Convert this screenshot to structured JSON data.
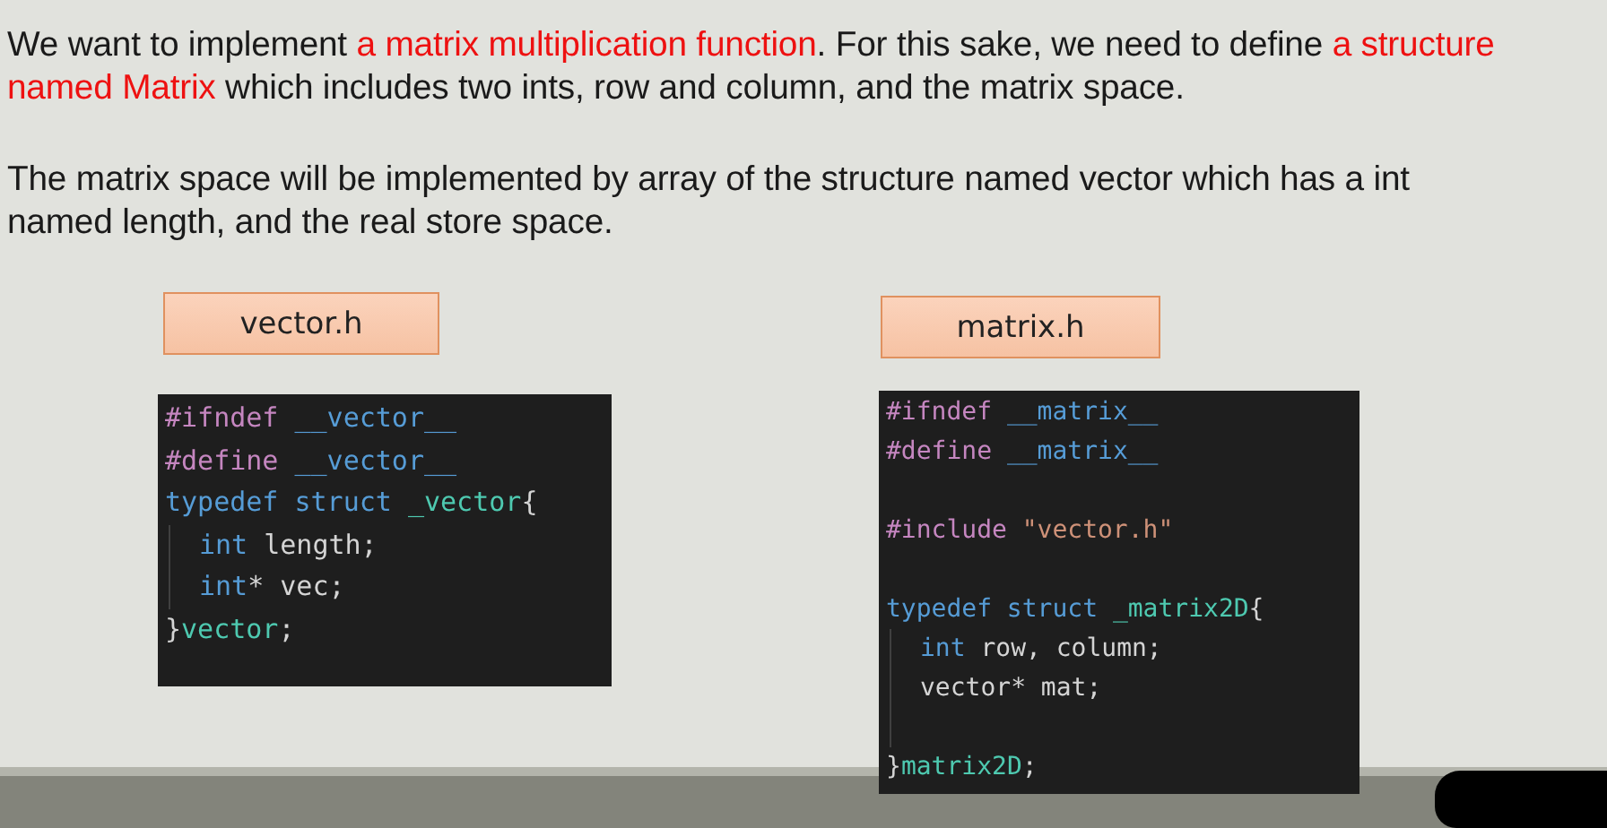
{
  "paragraphs": [
    {
      "segments": [
        {
          "text": "We want to implement ",
          "highlighted": false
        },
        {
          "text": "a matrix multiplication function",
          "highlighted": true
        },
        {
          "text": ". For this sake, we need to define ",
          "highlighted": false
        },
        {
          "text": "a structure named Matrix",
          "highlighted": true
        },
        {
          "text": " which includes two ints, row and column, and the matrix space.",
          "highlighted": false
        }
      ]
    },
    {
      "segments": [
        {
          "text": "The matrix space will be implemented by array of the structure named vector which has a int named length, and the real store space.",
          "highlighted": false
        }
      ]
    }
  ],
  "files": [
    {
      "name": "vector.h",
      "lines": [
        {
          "kind": "code",
          "tokens": [
            {
              "text": "#ifndef ",
              "kind": "directive"
            },
            {
              "text": "__vector__",
              "kind": "macro"
            }
          ]
        },
        {
          "kind": "code",
          "tokens": [
            {
              "text": "#define ",
              "kind": "directive"
            },
            {
              "text": "__vector__",
              "kind": "macro"
            }
          ]
        },
        {
          "kind": "code",
          "tokens": [
            {
              "text": "typedef struct ",
              "kind": "keyword"
            },
            {
              "text": "_vector",
              "kind": "type"
            },
            {
              "text": "{",
              "kind": "plain"
            }
          ],
          "children": [
            {
              "kind": "code",
              "tokens": [
                {
                  "text": "int ",
                  "kind": "keyword"
                },
                {
                  "text": "length;",
                  "kind": "plain"
                }
              ]
            },
            {
              "kind": "code",
              "tokens": [
                {
                  "text": "int",
                  "kind": "keyword"
                },
                {
                  "text": "* vec;",
                  "kind": "plain"
                }
              ]
            }
          ]
        },
        {
          "kind": "code",
          "tokens": [
            {
              "text": "}",
              "kind": "plain"
            },
            {
              "text": "vector",
              "kind": "type"
            },
            {
              "text": ";",
              "kind": "plain"
            }
          ]
        }
      ]
    },
    {
      "name": "matrix.h",
      "lines": [
        {
          "kind": "code",
          "tokens": [
            {
              "text": "#ifndef ",
              "kind": "directive"
            },
            {
              "text": "__matrix__",
              "kind": "macro"
            }
          ]
        },
        {
          "kind": "code",
          "tokens": [
            {
              "text": "#define ",
              "kind": "directive"
            },
            {
              "text": "__matrix__",
              "kind": "macro"
            }
          ]
        },
        {
          "kind": "blank"
        },
        {
          "kind": "code",
          "tokens": [
            {
              "text": "#include ",
              "kind": "directive"
            },
            {
              "text": "\"vector.h\"",
              "kind": "string"
            }
          ]
        },
        {
          "kind": "blank"
        },
        {
          "kind": "code",
          "tokens": [
            {
              "text": "typedef struct ",
              "kind": "keyword"
            },
            {
              "text": "_matrix2D",
              "kind": "type"
            },
            {
              "text": "{",
              "kind": "plain"
            }
          ],
          "children": [
            {
              "kind": "code",
              "tokens": [
                {
                  "text": "int ",
                  "kind": "keyword"
                },
                {
                  "text": "row, column;",
                  "kind": "plain"
                }
              ]
            },
            {
              "kind": "code",
              "tokens": [
                {
                  "text": "vector* mat;",
                  "kind": "plain"
                }
              ]
            },
            {
              "kind": "blank"
            }
          ]
        },
        {
          "kind": "code",
          "tokens": [
            {
              "text": "}",
              "kind": "plain"
            },
            {
              "text": "matrix2D",
              "kind": "type"
            },
            {
              "text": ";",
              "kind": "plain"
            }
          ]
        }
      ]
    }
  ]
}
